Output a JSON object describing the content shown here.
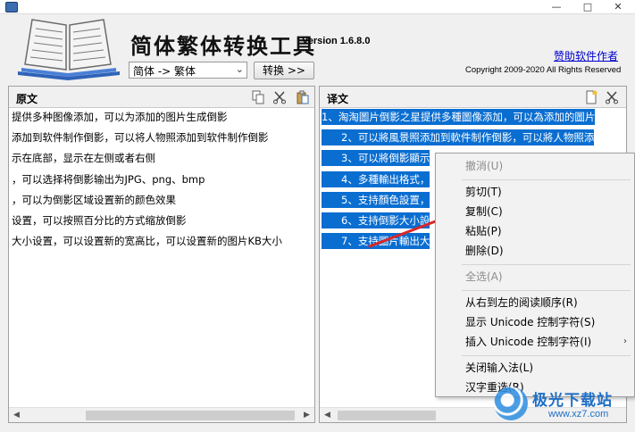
{
  "window": {
    "min_glyph": "—",
    "max_glyph": "□",
    "close_glyph": "✕"
  },
  "header": {
    "app_title": "简体繁体转换工具",
    "version": "Version 1.6.8.0",
    "sponsor_link": "赞助软件作者",
    "copyright": "Copyright 2009-2020 All Rights Reserved",
    "direction": "简体 -> 繁体",
    "convert_label": "转换 >>"
  },
  "source_panel": {
    "title": "原文",
    "lines": [
      "提供多种图像添加，可以为添加的图片生成倒影",
      "添加到软件制作倒影，可以将人物照添加到软件制作倒影",
      "示在底部，显示在左侧或者右侧",
      "，可以选择将倒影输出为JPG、png、bmp",
      "，可以为倒影区域设置新的颜色效果",
      "设置，可以按照百分比的方式缩放倒影",
      "大小设置，可以设置新的宽高比，可以设置新的图片KB大小"
    ]
  },
  "target_panel": {
    "title": "译文",
    "lines": [
      "1、淘淘圖片倒影之星提供多種圖像添加，可以為添加的圖片",
      "2、可以將風景照添加到軟件制作倒影，可以將人物照添",
      "3、可以將倒影顯示",
      "4、多種輸出格式，",
      "5、支持顏色設置，",
      "6、支持倒影大小設",
      "7、支持圖片輸出大"
    ]
  },
  "context_menu": {
    "items": [
      {
        "label": "撤消(U)",
        "enabled": false
      },
      {
        "label": "剪切(T)",
        "enabled": true
      },
      {
        "label": "复制(C)",
        "enabled": true
      },
      {
        "label": "粘贴(P)",
        "enabled": true
      },
      {
        "label": "删除(D)",
        "enabled": true
      },
      {
        "label": "全选(A)",
        "enabled": false
      },
      {
        "label": "从右到左的阅读顺序(R)",
        "enabled": true
      },
      {
        "label": "显示 Unicode 控制字符(S)",
        "enabled": true
      },
      {
        "label": "插入 Unicode 控制字符(I)",
        "enabled": true
      },
      {
        "label": "关闭输入法(L)",
        "enabled": true
      },
      {
        "label": "汉字重选(R)",
        "enabled": true
      }
    ]
  },
  "watermark": {
    "text": "极光下载站",
    "url": "www.xz7.com"
  },
  "colors": {
    "selection": "#0a6ed1",
    "link": "#0000cc",
    "arrow": "#d9262a"
  }
}
